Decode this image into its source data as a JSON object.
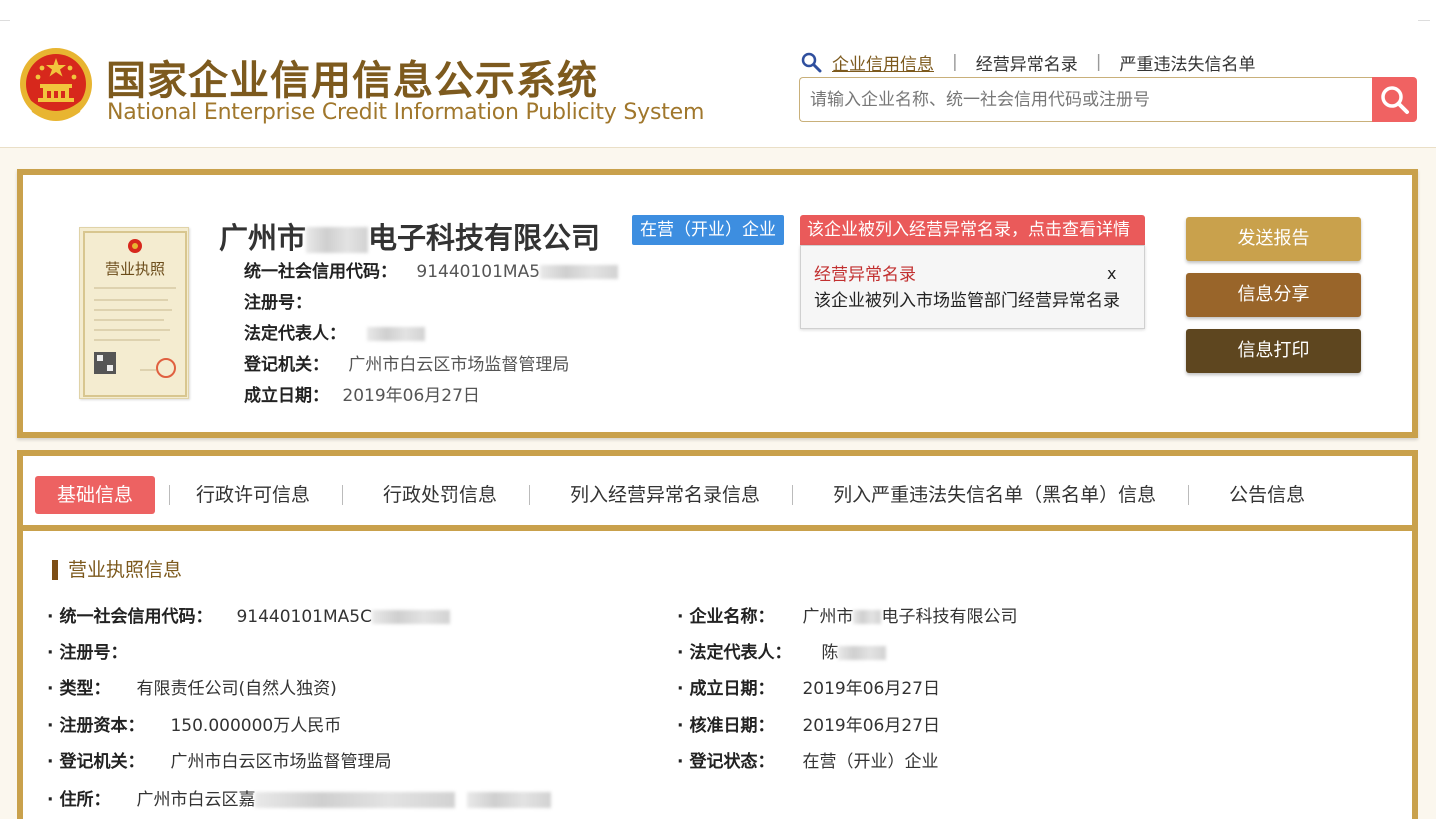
{
  "header": {
    "title_cn": "国家企业信用信息公示系统",
    "title_en": "National Enterprise Credit Information Publicity System",
    "nav": [
      {
        "label": "企业信用信息",
        "active": true
      },
      {
        "label": "经营异常名录",
        "active": false
      },
      {
        "label": "严重违法失信名单",
        "active": false
      }
    ],
    "nav_sep": "|",
    "search_placeholder": "请输入企业名称、统一社会信用代码或注册号",
    "icons": {
      "emblem": "national-emblem-icon",
      "search": "search-icon",
      "magnifier": "magnifier-icon"
    }
  },
  "company": {
    "name_prefix": "广州市",
    "name_suffix": "电子科技有限公司",
    "status_tag": "在营（开业）企业",
    "abnormal_banner": "该企业被列入经营异常名录，点击查看详情",
    "popup": {
      "title": "经营异常名录",
      "close": "x",
      "text": "该企业被列入市场监管部门经营异常名录"
    },
    "fields": {
      "credit_code": {
        "label": "统一社会信用代码：",
        "value": "91440101MA5"
      },
      "reg_no": {
        "label": "注册号："
      },
      "legal_rep": {
        "label": "法定代表人："
      },
      "reg_authority": {
        "label": "登记机关：",
        "value": "广州市白云区市场监督管理局"
      },
      "established": {
        "label": "成立日期：",
        "value": "2019年06月27日"
      }
    },
    "license_image": {
      "title": "营业执照"
    },
    "buttons": {
      "report": "发送报告",
      "share": "信息分享",
      "print": "信息打印"
    }
  },
  "tabs": [
    {
      "label": "基础信息",
      "active": true
    },
    {
      "label": "行政许可信息"
    },
    {
      "label": "行政处罚信息"
    },
    {
      "label": "列入经营异常名录信息"
    },
    {
      "label": "列入严重违法失信名单（黑名单）信息"
    },
    {
      "label": "公告信息"
    }
  ],
  "license_info": {
    "section_title": "营业执照信息",
    "bullet": "·",
    "left": {
      "credit_code": {
        "label": "统一社会信用代码：",
        "value": "91440101MA5C"
      },
      "reg_no": {
        "label": "注册号："
      },
      "type": {
        "label": "类型：",
        "value": "有限责任公司(自然人独资)"
      },
      "capital": {
        "label": "注册资本：",
        "value": "150.000000万人民币"
      },
      "authority": {
        "label": "登记机关：",
        "value": "广州市白云区市场监督管理局"
      },
      "address": {
        "label": "住所：",
        "value": "广州市白云区嘉"
      }
    },
    "right": {
      "company_name": {
        "label": "企业名称：",
        "value_prefix": "广州市",
        "value_suffix": "电子科技有限公司"
      },
      "legal_rep": {
        "label": "法定代表人：",
        "value": "陈"
      },
      "established": {
        "label": "成立日期：",
        "value": "2019年06月27日"
      },
      "approved": {
        "label": "核准日期：",
        "value": "2019年06月27日"
      },
      "status": {
        "label": "登记状态：",
        "value": "在营（开业）企业"
      }
    }
  }
}
